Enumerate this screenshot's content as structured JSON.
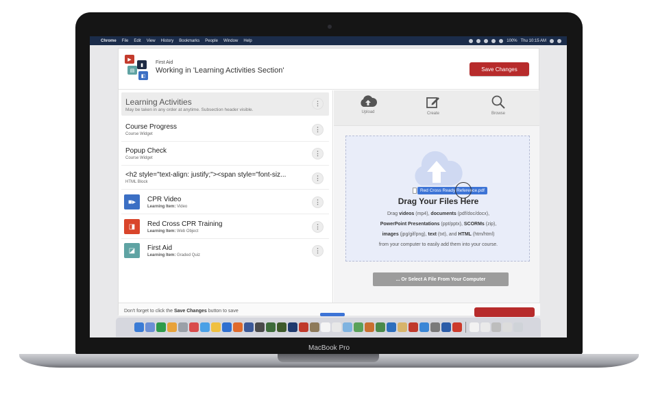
{
  "device": {
    "label": "MacBook Pro"
  },
  "menubar": {
    "app": "Chrome",
    "items": [
      "File",
      "Edit",
      "View",
      "History",
      "Bookmarks",
      "People",
      "Window",
      "Help"
    ],
    "battery": "100%",
    "clock": "Thu 10:15 AM"
  },
  "header": {
    "course": "First Aid",
    "title": "Working in 'Learning Activities Section'",
    "save_label": "Save Changes"
  },
  "section": {
    "title": "Learning Activities",
    "subtitle": "May be taken in any order at anytime. Subsection header visible."
  },
  "items": [
    {
      "title": "Course Progress",
      "type": "Course Widget"
    },
    {
      "title": "Popup Check",
      "type": "Course Widget"
    },
    {
      "title": "<h2 style=\"text-align: justify;\"><span style=\"font-siz...",
      "type": "HTML Block"
    }
  ],
  "learning_items": [
    {
      "title": "CPR Video",
      "prefix": "Learning Item:",
      "kind": "Video",
      "color": "#3b6fc4",
      "icon": "video-camera-icon"
    },
    {
      "title": "Red Cross CPR Training",
      "prefix": "Learning Item:",
      "kind": "Web Object",
      "color": "#d9452b",
      "icon": "web-object-icon"
    },
    {
      "title": "First Aid",
      "prefix": "Learning Item:",
      "kind": "Graded Quiz",
      "color": "#5fa3a3",
      "icon": "quiz-icon"
    }
  ],
  "tools": [
    {
      "label": "Upload",
      "icon": "cloud-upload-icon"
    },
    {
      "label": "Create",
      "icon": "pencil-square-icon"
    },
    {
      "label": "Browse",
      "icon": "magnifier-icon"
    }
  ],
  "dropzone": {
    "file_chip": "Red Cross Ready Reference.pdf",
    "title": "Drag Your Files Here",
    "line1_pre": "Drag ",
    "videos": "videos",
    "line1_mid1": " (mp4), ",
    "documents": "documents",
    "line1_post": " (pdf/doc/docx),",
    "ppt": "PowerPoint Presentations",
    "line2_mid": " (ppt/pptx), ",
    "scorm": "SCORMs",
    "line2_post": " (zip),",
    "images": "images",
    "line3_mid1": " (jpg/gif/png), ",
    "text": "text",
    "line3_mid2": " (txt), and ",
    "html": "HTML",
    "line3_post": " (htm/html)",
    "line4": "from your computer to easily add them into your course.",
    "select_label": "... Or Select A File From Your Computer"
  },
  "footer": {
    "pre": "Don't forget to click the ",
    "bold": "Save Changes",
    "post": " button to save"
  },
  "colors": {
    "save": "#b72b2b",
    "menubar": "#1b2c4a",
    "dropzone": "#e9edf9",
    "chip": "#3d74d6"
  }
}
